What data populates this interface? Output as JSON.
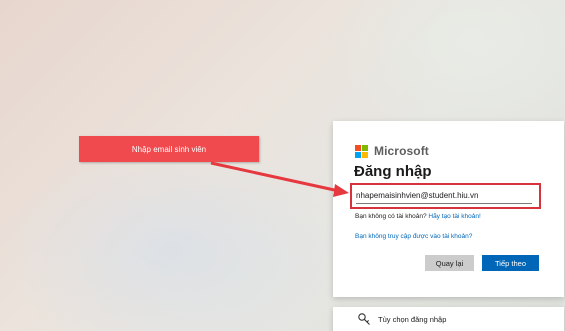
{
  "login_card": {
    "brand": "Microsoft",
    "title": "Đăng nhập",
    "email_value": "nhapemaisinhvien@student.hiu.vn",
    "no_account_text": "Bạn không có tài khoản?",
    "create_account_link": "Hãy tạo tài khoản!",
    "cant_access_link": "Bạn không truy cập được vào tài khoản?",
    "back_button": "Quay lại",
    "next_button": "Tiếp theo"
  },
  "sign_in_options": {
    "label": "Tùy chọn đăng nhập",
    "icon": "key-search-icon"
  },
  "annotation": {
    "callout_text": "Nhập email sinh viên"
  },
  "colors": {
    "accent_blue": "#0067b8",
    "callout_red": "#f04a4e",
    "highlight_border": "#d7333d",
    "ms_red": "#f25022",
    "ms_green": "#7fba00",
    "ms_blue": "#00a4ef",
    "ms_yellow": "#ffb900"
  }
}
